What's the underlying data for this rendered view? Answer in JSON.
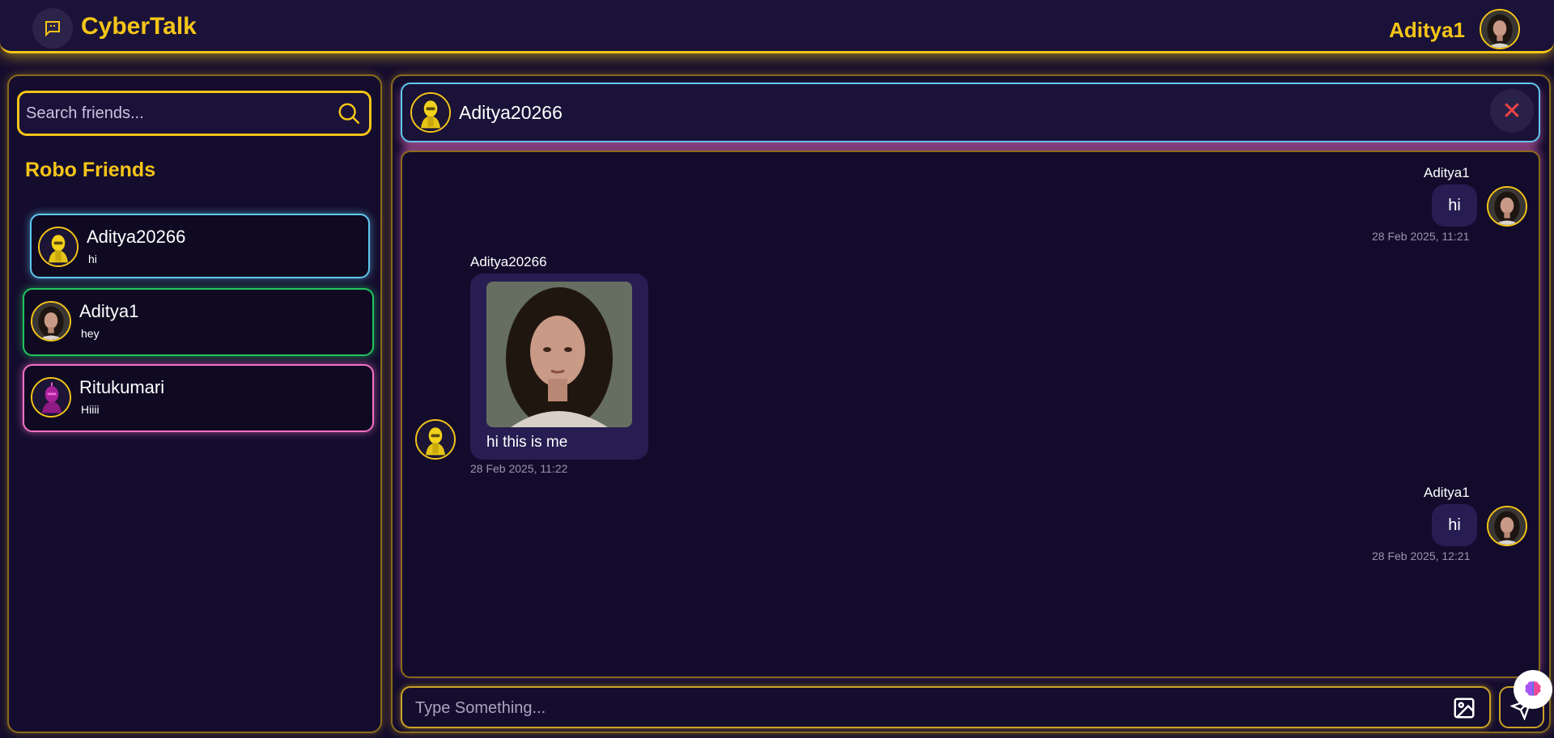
{
  "app": {
    "title": "CyberTalk",
    "logo_icon": "chat-bubble-icon"
  },
  "current_user": {
    "name": "Aditya1",
    "avatar": "woman-portrait"
  },
  "colors": {
    "accent": "#f5c518",
    "background": "#150d2e",
    "cyan": "#5fc8ee",
    "green": "#22c55e",
    "pink": "#f472c8",
    "danger": "#ef4444",
    "bubble": "#271d52"
  },
  "sidebar": {
    "search": {
      "placeholder": "Search friends...",
      "value": "",
      "icon": "search-icon"
    },
    "section_title": "Robo Friends",
    "friends": [
      {
        "name": "Aditya20266",
        "last_message": "hi",
        "avatar": "yellow-robot",
        "border": "#5fc8ee",
        "active": true
      },
      {
        "name": "Aditya1",
        "last_message": "hey",
        "avatar": "woman-portrait",
        "border": "#22c55e",
        "active": false
      },
      {
        "name": "Ritukumari",
        "last_message": "Hiiii",
        "avatar": "purple-robot",
        "border": "#f472c8",
        "active": false
      }
    ]
  },
  "chat": {
    "header": {
      "name": "Aditya20266",
      "avatar": "yellow-robot",
      "close_icon": "close-icon"
    },
    "messages": [
      {
        "direction": "outgoing",
        "sender": "Aditya1",
        "text": "hi",
        "time": "28 Feb 2025, 11:21"
      },
      {
        "direction": "incoming",
        "sender": "Aditya20266",
        "text": "hi this is me",
        "has_image": true,
        "time": "28 Feb 2025, 11:22"
      },
      {
        "direction": "outgoing",
        "sender": "Aditya1",
        "text": "hi",
        "time": "28 Feb 2025, 12:21"
      }
    ]
  },
  "composer": {
    "placeholder": "Type Something...",
    "value": "",
    "image_icon": "image-icon",
    "send_icon": "send-icon"
  },
  "floating": {
    "icon": "brain-icon"
  }
}
